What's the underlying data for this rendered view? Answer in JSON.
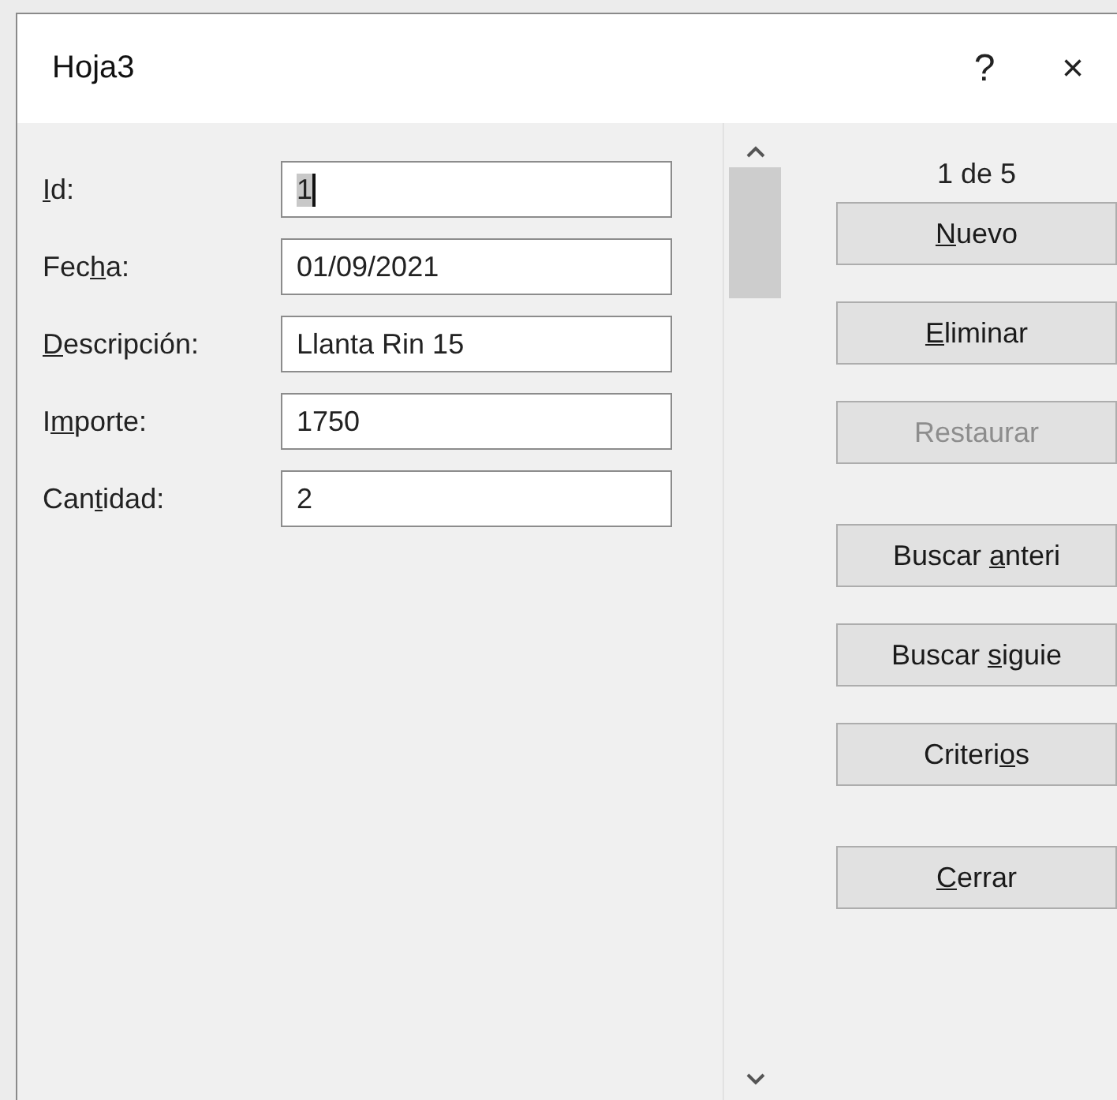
{
  "window": {
    "title": "Hoja3",
    "help": "?",
    "close": "×"
  },
  "fields": [
    {
      "label": {
        "key": "I",
        "after": "d:"
      },
      "value": "1",
      "focused": true
    },
    {
      "label": {
        "before": "Fec",
        "key": "h",
        "after": "a:"
      },
      "value": "01/09/2021",
      "focused": false
    },
    {
      "label": {
        "key": "D",
        "after": "escripción:"
      },
      "value": "Llanta Rin 15",
      "focused": false
    },
    {
      "label": {
        "before": "I",
        "key": "m",
        "after": "porte:"
      },
      "value": "1750",
      "focused": false
    },
    {
      "label": {
        "before": "Can",
        "key": "t",
        "after": "idad:"
      },
      "value": "2",
      "focused": false
    }
  ],
  "record_counter": "1 de 5",
  "button_groups": [
    [
      {
        "label": {
          "key": "N",
          "after": "uevo"
        },
        "disabled": false
      },
      {
        "label": {
          "key": "E",
          "after": "liminar"
        },
        "disabled": false
      },
      {
        "label": {
          "before": "Restaurar"
        },
        "disabled": true
      }
    ],
    [
      {
        "label": {
          "before": "Buscar ",
          "key": "a",
          "after": "nteri"
        },
        "disabled": false
      },
      {
        "label": {
          "before": "Buscar ",
          "key": "s",
          "after": "iguie"
        },
        "disabled": false
      },
      {
        "label": {
          "before": "Criteri",
          "key": "o",
          "after": "s"
        },
        "disabled": false
      }
    ],
    [
      {
        "label": {
          "key": "C",
          "after": "errar"
        },
        "disabled": false
      }
    ]
  ]
}
